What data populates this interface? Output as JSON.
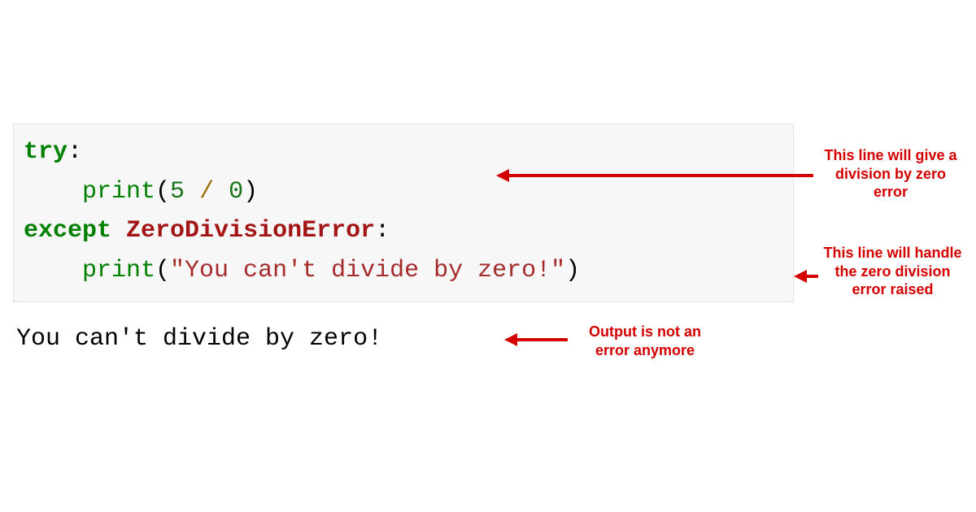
{
  "code": {
    "line1": {
      "try": "try",
      "colon": ":"
    },
    "line2": {
      "indent": "    ",
      "print": "print",
      "lpar": "(",
      "n1": "5",
      "sp1": " ",
      "slash": "/",
      "sp2": " ",
      "n2": "0",
      "rpar": ")"
    },
    "line3": {
      "except": "except",
      "sp": " ",
      "exc": "ZeroDivisionError",
      "colon": ":"
    },
    "line4": {
      "indent": "    ",
      "print": "print",
      "lpar": "(",
      "str": "\"You can't divide by zero!\"",
      "rpar": ")"
    }
  },
  "output": "You can't divide by zero!",
  "annotations": {
    "a1": "This line will give a division by zero error",
    "a2": "This line will handle the zero division error raised",
    "a3": "Output is not an error anymore"
  },
  "colors": {
    "annotation": "#d40000"
  }
}
